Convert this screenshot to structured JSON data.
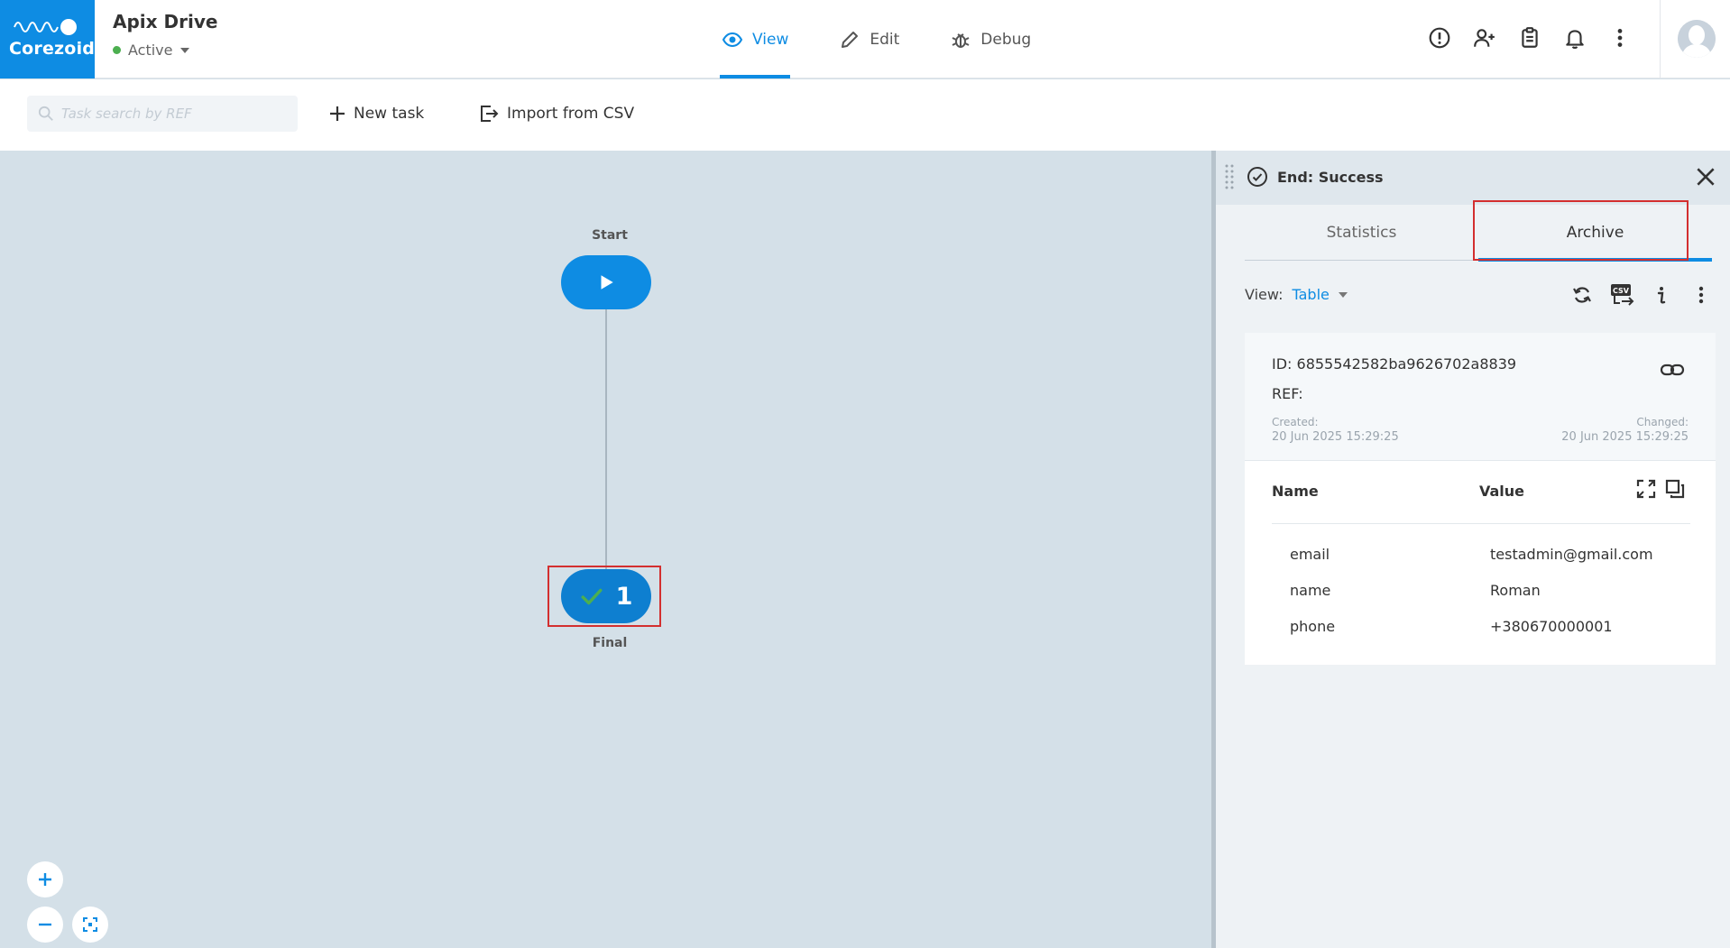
{
  "app": {
    "logo_text": "Corezoid",
    "process_title": "Apix Drive",
    "status": "Active"
  },
  "modes": [
    {
      "label": "View",
      "icon": "eye-icon",
      "active": true
    },
    {
      "label": "Edit",
      "icon": "pencil-icon",
      "active": false
    },
    {
      "label": "Debug",
      "icon": "bug-icon",
      "active": false
    }
  ],
  "header_icons": [
    "alert-circle-icon",
    "add-user-icon",
    "clipboard-icon",
    "bell-icon",
    "more-vertical-icon"
  ],
  "toolbar": {
    "search_placeholder": "Task search by REF",
    "new_task_label": "New task",
    "import_label": "Import from CSV"
  },
  "canvas": {
    "start_label": "Start",
    "final_label": "Final",
    "final_count": "1"
  },
  "panel": {
    "title": "End: Success",
    "tabs": [
      {
        "label": "Statistics",
        "active": false
      },
      {
        "label": "Archive",
        "active": true
      }
    ],
    "view_label": "View:",
    "view_value": "Table",
    "task": {
      "id_text": "ID: 6855542582ba9626702a8839",
      "ref_text": "REF:",
      "created_label": "Created:",
      "created_value": "20 Jun 2025 15:29:25",
      "changed_label": "Changed:",
      "changed_value": "20 Jun 2025 15:29:25"
    },
    "table": {
      "col_name": "Name",
      "col_value": "Value",
      "rows": [
        {
          "name": "email",
          "value": "testadmin@gmail.com"
        },
        {
          "name": "name",
          "value": "Roman"
        },
        {
          "name": "phone",
          "value": "+380670000001"
        }
      ]
    }
  },
  "colors": {
    "accent": "#0e8ce3",
    "canvas_bg": "#d4e0e8",
    "success_green": "#4caf50",
    "highlight_red": "#d32f2f"
  }
}
